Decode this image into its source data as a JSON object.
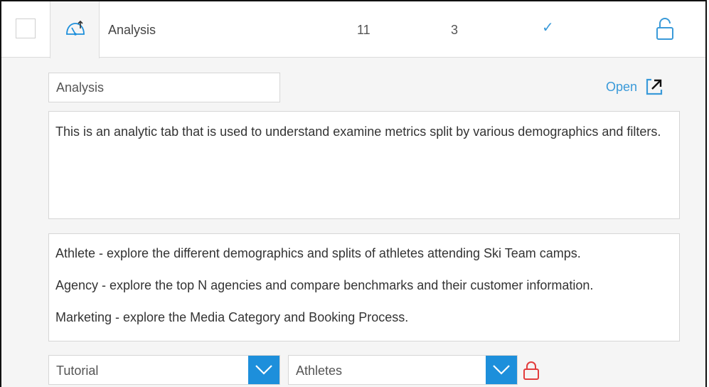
{
  "header": {
    "title": "Analysis",
    "count_a": "11",
    "count_b": "3",
    "status_check": "✓",
    "tab_icon": "dashboard-tab-icon",
    "lock_icon": "unlocked-padlock-icon"
  },
  "form": {
    "name_value": "Analysis",
    "open_label": "Open",
    "open_icon": "external-link-icon",
    "description": "This is an analytic tab that is used to understand examine metrics split by various demographics and filters.",
    "sub_tabs": [
      "Athlete - explore the different demographics and splits of athletes attending Ski Team camps.",
      "Agency - explore the top N agencies and compare benchmarks and their customer information.",
      "Marketing - explore the Media Category and Booking Process."
    ],
    "category_select": "Tutorial",
    "subcategory_select": "Athletes",
    "subcategory_lock_icon": "locked-padlock-icon"
  },
  "colors": {
    "accent": "#1d8fdb",
    "link": "#3a9ad9",
    "lock_red": "#e23d3d",
    "panel_bg": "#f5f5f5"
  }
}
